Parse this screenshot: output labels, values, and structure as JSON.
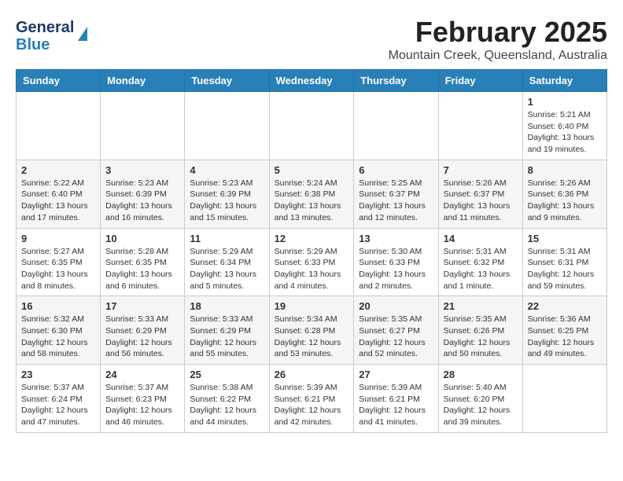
{
  "header": {
    "title": "February 2025",
    "subtitle": "Mountain Creek, Queensland, Australia",
    "logo_general": "General",
    "logo_blue": "Blue"
  },
  "days_of_week": [
    "Sunday",
    "Monday",
    "Tuesday",
    "Wednesday",
    "Thursday",
    "Friday",
    "Saturday"
  ],
  "weeks": [
    {
      "shade": "white",
      "days": [
        {
          "num": "",
          "info": ""
        },
        {
          "num": "",
          "info": ""
        },
        {
          "num": "",
          "info": ""
        },
        {
          "num": "",
          "info": ""
        },
        {
          "num": "",
          "info": ""
        },
        {
          "num": "",
          "info": ""
        },
        {
          "num": "1",
          "info": "Sunrise: 5:21 AM\nSunset: 6:40 PM\nDaylight: 13 hours and 19 minutes."
        }
      ]
    },
    {
      "shade": "shade",
      "days": [
        {
          "num": "2",
          "info": "Sunrise: 5:22 AM\nSunset: 6:40 PM\nDaylight: 13 hours and 17 minutes."
        },
        {
          "num": "3",
          "info": "Sunrise: 5:23 AM\nSunset: 6:39 PM\nDaylight: 13 hours and 16 minutes."
        },
        {
          "num": "4",
          "info": "Sunrise: 5:23 AM\nSunset: 6:39 PM\nDaylight: 13 hours and 15 minutes."
        },
        {
          "num": "5",
          "info": "Sunrise: 5:24 AM\nSunset: 6:38 PM\nDaylight: 13 hours and 13 minutes."
        },
        {
          "num": "6",
          "info": "Sunrise: 5:25 AM\nSunset: 6:37 PM\nDaylight: 13 hours and 12 minutes."
        },
        {
          "num": "7",
          "info": "Sunrise: 5:26 AM\nSunset: 6:37 PM\nDaylight: 13 hours and 11 minutes."
        },
        {
          "num": "8",
          "info": "Sunrise: 5:26 AM\nSunset: 6:36 PM\nDaylight: 13 hours and 9 minutes."
        }
      ]
    },
    {
      "shade": "white",
      "days": [
        {
          "num": "9",
          "info": "Sunrise: 5:27 AM\nSunset: 6:35 PM\nDaylight: 13 hours and 8 minutes."
        },
        {
          "num": "10",
          "info": "Sunrise: 5:28 AM\nSunset: 6:35 PM\nDaylight: 13 hours and 6 minutes."
        },
        {
          "num": "11",
          "info": "Sunrise: 5:29 AM\nSunset: 6:34 PM\nDaylight: 13 hours and 5 minutes."
        },
        {
          "num": "12",
          "info": "Sunrise: 5:29 AM\nSunset: 6:33 PM\nDaylight: 13 hours and 4 minutes."
        },
        {
          "num": "13",
          "info": "Sunrise: 5:30 AM\nSunset: 6:33 PM\nDaylight: 13 hours and 2 minutes."
        },
        {
          "num": "14",
          "info": "Sunrise: 5:31 AM\nSunset: 6:32 PM\nDaylight: 13 hours and 1 minute."
        },
        {
          "num": "15",
          "info": "Sunrise: 5:31 AM\nSunset: 6:31 PM\nDaylight: 12 hours and 59 minutes."
        }
      ]
    },
    {
      "shade": "shade",
      "days": [
        {
          "num": "16",
          "info": "Sunrise: 5:32 AM\nSunset: 6:30 PM\nDaylight: 12 hours and 58 minutes."
        },
        {
          "num": "17",
          "info": "Sunrise: 5:33 AM\nSunset: 6:29 PM\nDaylight: 12 hours and 56 minutes."
        },
        {
          "num": "18",
          "info": "Sunrise: 5:33 AM\nSunset: 6:29 PM\nDaylight: 12 hours and 55 minutes."
        },
        {
          "num": "19",
          "info": "Sunrise: 5:34 AM\nSunset: 6:28 PM\nDaylight: 12 hours and 53 minutes."
        },
        {
          "num": "20",
          "info": "Sunrise: 5:35 AM\nSunset: 6:27 PM\nDaylight: 12 hours and 52 minutes."
        },
        {
          "num": "21",
          "info": "Sunrise: 5:35 AM\nSunset: 6:26 PM\nDaylight: 12 hours and 50 minutes."
        },
        {
          "num": "22",
          "info": "Sunrise: 5:36 AM\nSunset: 6:25 PM\nDaylight: 12 hours and 49 minutes."
        }
      ]
    },
    {
      "shade": "white",
      "days": [
        {
          "num": "23",
          "info": "Sunrise: 5:37 AM\nSunset: 6:24 PM\nDaylight: 12 hours and 47 minutes."
        },
        {
          "num": "24",
          "info": "Sunrise: 5:37 AM\nSunset: 6:23 PM\nDaylight: 12 hours and 46 minutes."
        },
        {
          "num": "25",
          "info": "Sunrise: 5:38 AM\nSunset: 6:22 PM\nDaylight: 12 hours and 44 minutes."
        },
        {
          "num": "26",
          "info": "Sunrise: 5:39 AM\nSunset: 6:21 PM\nDaylight: 12 hours and 42 minutes."
        },
        {
          "num": "27",
          "info": "Sunrise: 5:39 AM\nSunset: 6:21 PM\nDaylight: 12 hours and 41 minutes."
        },
        {
          "num": "28",
          "info": "Sunrise: 5:40 AM\nSunset: 6:20 PM\nDaylight: 12 hours and 39 minutes."
        },
        {
          "num": "",
          "info": ""
        }
      ]
    }
  ]
}
